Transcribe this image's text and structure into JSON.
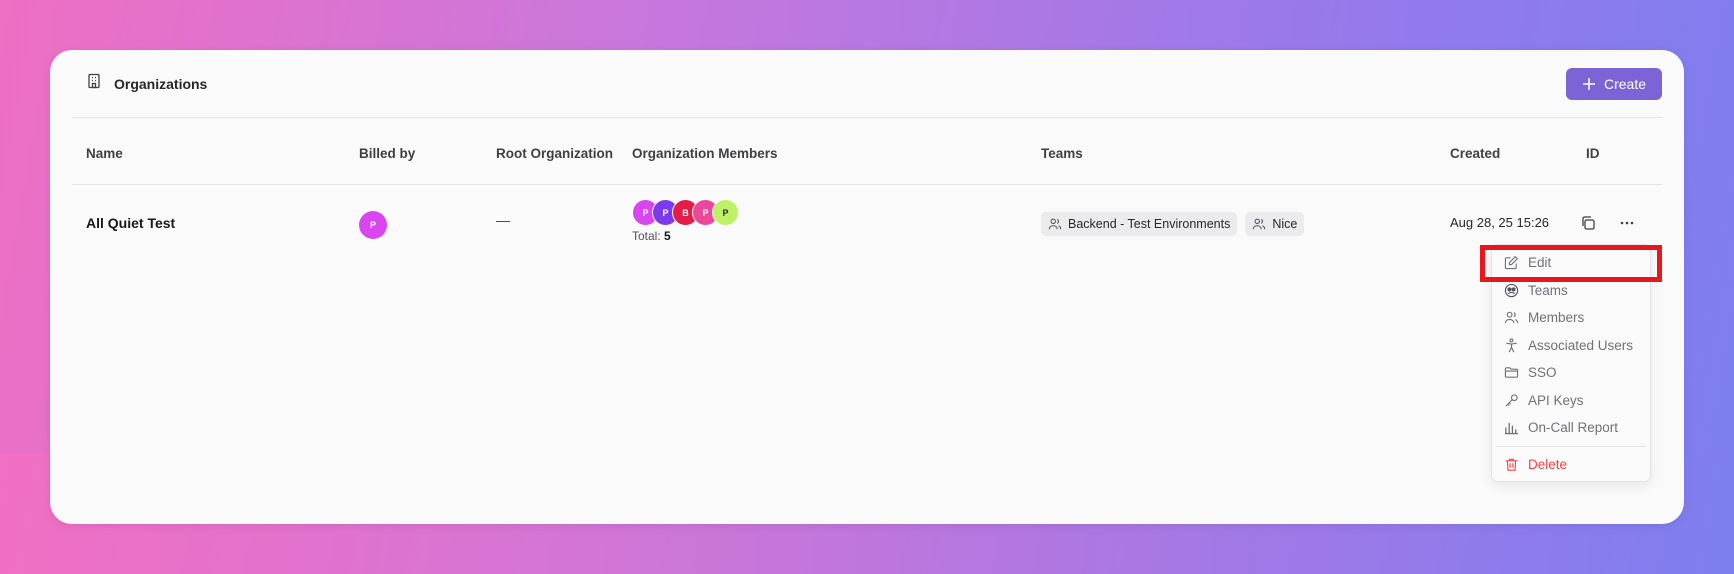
{
  "header": {
    "title": "Organizations",
    "create_label": "Create"
  },
  "columns": [
    "Name",
    "Billed by",
    "Root Organization",
    "Organization Members",
    "Teams",
    "Created",
    "ID"
  ],
  "row": {
    "name": "All Quiet Test",
    "billed_by_initial": "P",
    "root_org": "—",
    "members": [
      {
        "initial": "P",
        "color": "#d946ef"
      },
      {
        "initial": "P",
        "color": "#7c3aed"
      },
      {
        "initial": "B",
        "color": "#e11d48"
      },
      {
        "initial": "P",
        "color": "#ec4899"
      },
      {
        "initial": "P",
        "color": "#bef264"
      }
    ],
    "total_label": "Total:",
    "total_count": "5",
    "teams": [
      "Backend - Test Environments",
      "Nice"
    ],
    "created": "Aug 28, 25 15:26"
  },
  "menu": {
    "items": [
      "Edit",
      "Teams",
      "Members",
      "Associated Users",
      "SSO",
      "API Keys",
      "On-Call Report"
    ],
    "delete_label": "Delete"
  },
  "colors": {
    "accent": "#7c63d6",
    "danger": "#ef4444",
    "highlight": "#e8171d"
  }
}
